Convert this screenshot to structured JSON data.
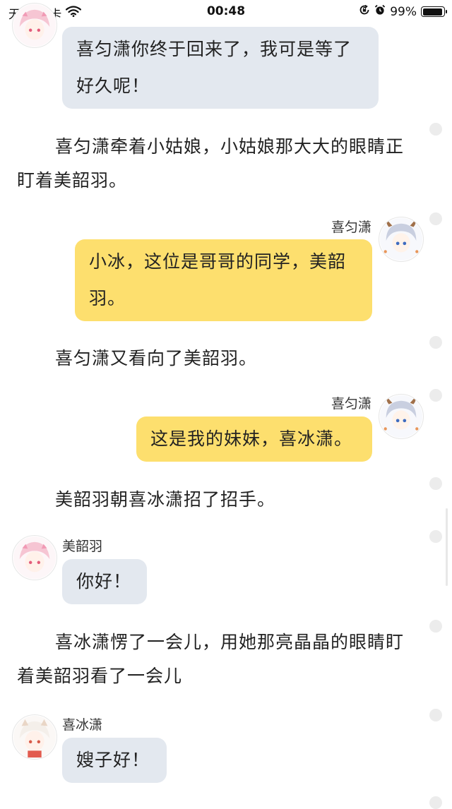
{
  "status_bar": {
    "carrier": "无 SIM 卡",
    "time": "00:48",
    "battery_percent": "99%",
    "battery_level": 0.99,
    "icons": [
      "wifi-icon",
      "orientation-lock-icon",
      "alarm-icon",
      "battery-icon"
    ]
  },
  "messages": [
    {
      "type": "bubble",
      "side": "left",
      "speaker": "",
      "avatar": "pink-hair-girl-avatar",
      "text_lines": [
        "喜匀潇你终于回来了，我可是等了",
        "好久呢！"
      ]
    },
    {
      "type": "narration",
      "text": "喜匀潇牵着小姑娘，小姑娘那大大的眼睛正盯着美韶羽。"
    },
    {
      "type": "bubble",
      "side": "right",
      "speaker": "喜匀潇",
      "avatar": "silver-hair-boy-avatar",
      "text_lines": [
        "小冰，这位是哥哥的同学，美韶",
        "羽。"
      ]
    },
    {
      "type": "narration",
      "text": "喜匀潇又看向了美韶羽。"
    },
    {
      "type": "bubble",
      "side": "right",
      "speaker": "喜匀潇",
      "avatar": "silver-hair-boy-avatar",
      "text_lines": [
        "这是我的妹妹，喜冰潇。"
      ]
    },
    {
      "type": "narration",
      "text": "美韶羽朝喜冰潇招了招手。"
    },
    {
      "type": "bubble",
      "side": "left",
      "speaker": "美韶羽",
      "avatar": "pink-hair-girl-avatar",
      "text_lines": [
        "你好！"
      ]
    },
    {
      "type": "narration",
      "text": "喜冰潇愣了一会儿，用她那亮晶晶的眼睛盯着美韶羽看了一会儿"
    },
    {
      "type": "bubble",
      "side": "left",
      "speaker": "喜冰潇",
      "avatar": "white-hair-girl-avatar",
      "text_lines": [
        "嫂子好！"
      ]
    }
  ],
  "colors": {
    "left_bubble": "#e3e8ef",
    "right_bubble": "#fddf6e",
    "side_dot": "#ececec"
  }
}
